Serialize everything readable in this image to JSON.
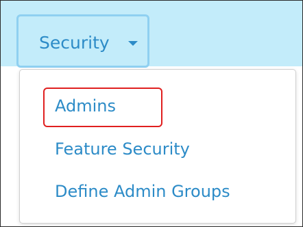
{
  "navbar": {
    "menu_button_label": "Security",
    "menu_button_icon": "caret-down-icon",
    "background_color": "#c3ecfa",
    "accent_color": "#2c8bc7"
  },
  "dropdown": {
    "items": [
      {
        "label": "Admins",
        "highlighted": true
      },
      {
        "label": "Feature Security",
        "highlighted": false
      },
      {
        "label": "Define Admin Groups",
        "highlighted": false
      }
    ],
    "highlight_color": "#e01f1f"
  }
}
